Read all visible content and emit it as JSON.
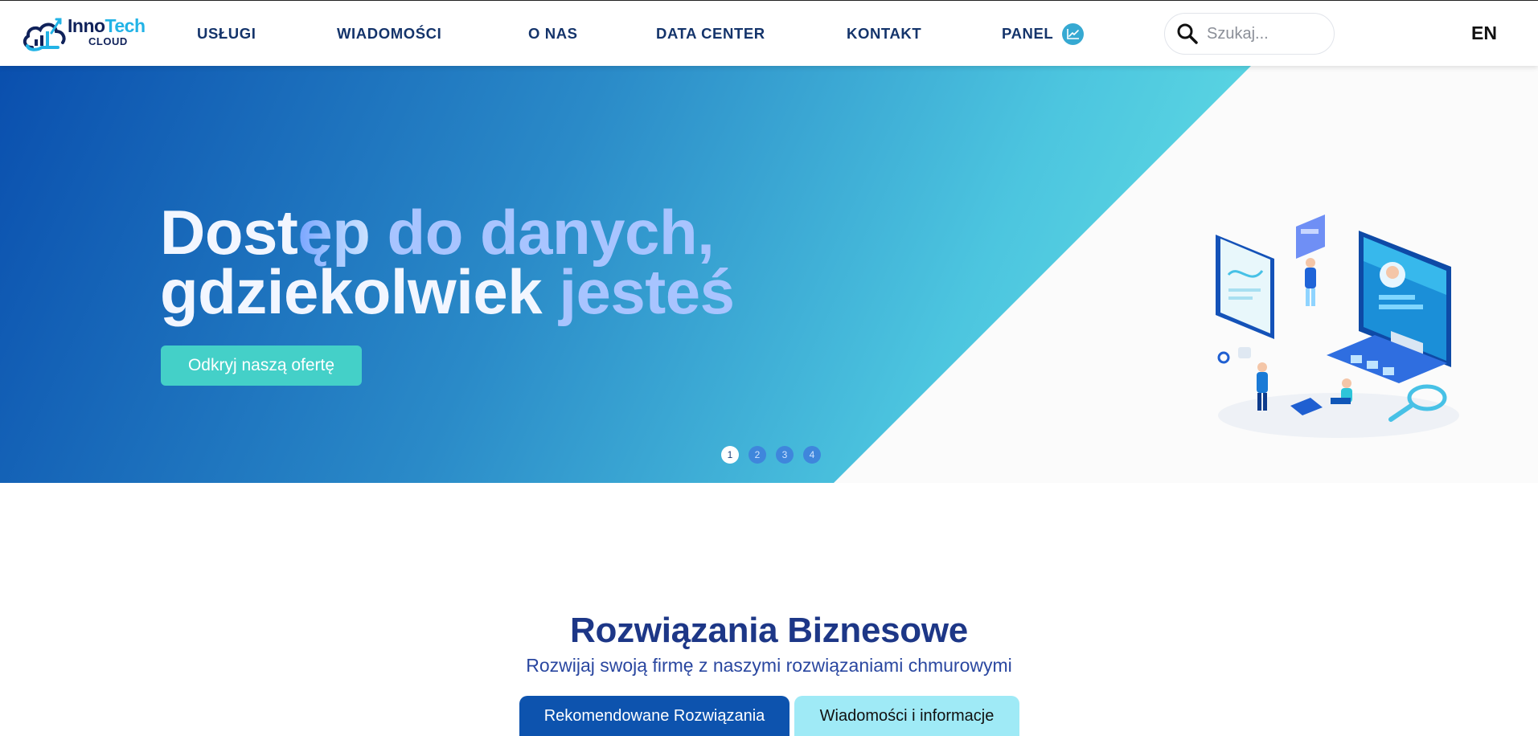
{
  "header": {
    "logo": {
      "part1": "Inno",
      "part2": "Tech",
      "part3": "CLOUD"
    },
    "nav": [
      {
        "label": "USŁUGI"
      },
      {
        "label": "WIADOMOŚCI"
      },
      {
        "label": "O NAS"
      },
      {
        "label": "DATA CENTER"
      },
      {
        "label": "KONTAKT"
      },
      {
        "label": "PANEL",
        "icon": "chart-line-icon"
      }
    ],
    "search": {
      "placeholder": "Szukaj...",
      "value": "",
      "icon": "search-icon"
    },
    "language": "EN"
  },
  "hero": {
    "title": {
      "line1": {
        "a": "Dost",
        "b": "ęp ",
        "c": "do danych,"
      },
      "line2": {
        "a": "gdziekolwiek ",
        "b": "jesteś"
      }
    },
    "button": "Odkryj naszą ofertę",
    "slides": [
      "1",
      "2",
      "3",
      "4"
    ],
    "active_slide": 1,
    "colors": {
      "gradient_start": "#0a4fae",
      "gradient_end": "#67e4e5",
      "button": "#44d0c8"
    }
  },
  "section": {
    "title": "Rozwiązania Biznesowe",
    "subtitle": "Rozwijaj swoją firmę z naszymi rozwiązaniami chmurowymi",
    "tabs": [
      {
        "label": "Rekomendowane Rozwiązania",
        "active": true
      },
      {
        "label": "Wiadomości i informacje",
        "active": false
      }
    ]
  }
}
